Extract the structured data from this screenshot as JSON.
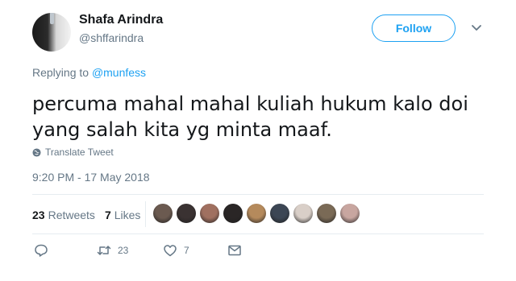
{
  "author": {
    "name": "Shafa Arindra",
    "handle": "@shffarindra"
  },
  "follow_label": "Follow",
  "replying": {
    "prefix": "Replying to ",
    "target": "@munfess"
  },
  "tweet_text": "percuma mahal mahal kuliah hukum kalo doi yang salah kita yg minta maaf.",
  "translate_label": "Translate Tweet",
  "timestamp": "9:20 PM - 17 May 2018",
  "stats": {
    "retweets_count": "23",
    "retweets_label": "Retweets",
    "likes_count": "7",
    "likes_label": "Likes"
  },
  "liker_avatar_colors": [
    "#6b5a50",
    "#3a3232",
    "#a07060",
    "#2a2626",
    "#b58a5c",
    "#3c4654",
    "#d9cfc8",
    "#7a6a56",
    "#c8a6a0"
  ],
  "actions": {
    "reply_icon": "reply-icon",
    "retweet_icon": "retweet-icon",
    "retweet_count": "23",
    "like_icon": "heart-icon",
    "like_count": "7",
    "dm_icon": "envelope-icon"
  },
  "colors": {
    "accent": "#1da1f2",
    "secondary_text": "#657786",
    "primary_text": "#14171a",
    "divider": "#e6ecf0"
  }
}
